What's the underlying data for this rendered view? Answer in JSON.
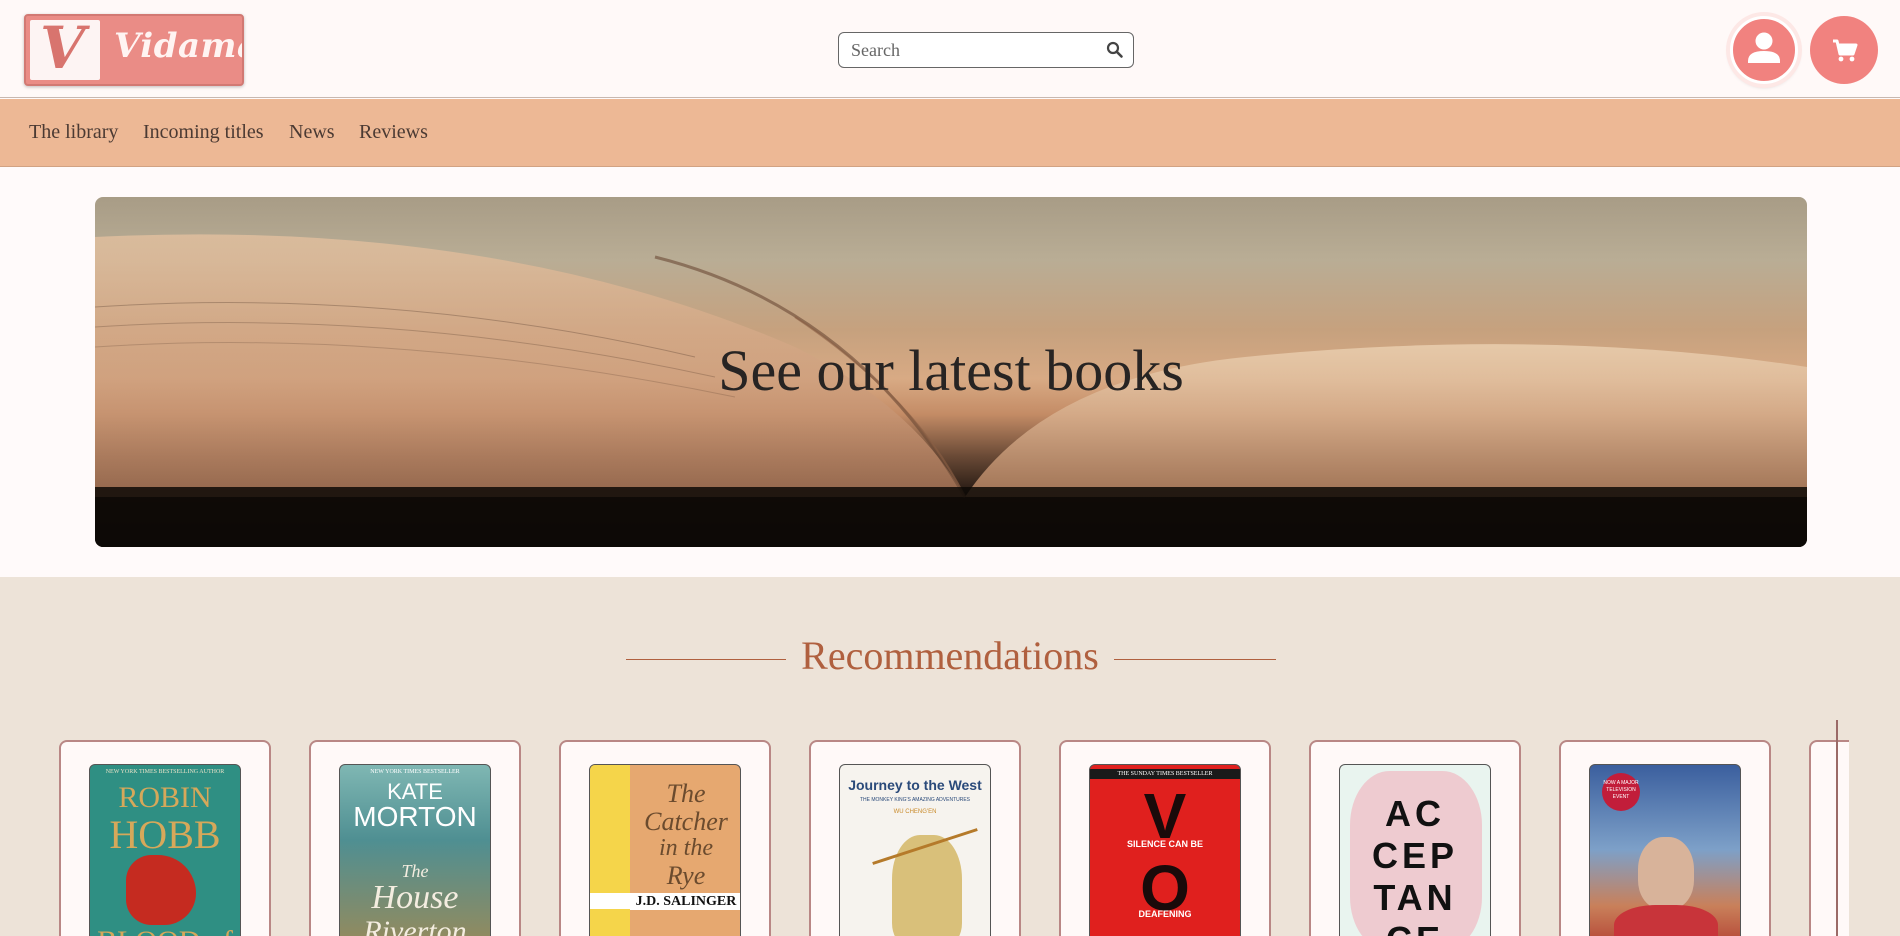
{
  "brand": {
    "logo_letter": "V",
    "logo_text": "Vidama"
  },
  "search": {
    "placeholder": "Search"
  },
  "nav": {
    "items": [
      "The library",
      "Incoming titles",
      "News",
      "Reviews"
    ]
  },
  "hero": {
    "title": "See our latest books"
  },
  "recommendations": {
    "title": "Recommendations",
    "books": [
      {
        "cover_lines": [
          "ROBIN",
          "HOBB",
          "BLOOD of"
        ],
        "tagline": "NEW YORK TIMES BESTSELLING AUTHOR"
      },
      {
        "cover_lines": [
          "KATE",
          "MORTON",
          "The",
          "House",
          "Riverton"
        ],
        "tagline": "NEW YORK TIMES BESTSELLER"
      },
      {
        "cover_lines": [
          "The",
          "Catcher",
          "in the",
          "Rye",
          "J.D. SALINGER"
        ]
      },
      {
        "cover_lines": [
          "Journey to the West",
          "THE MONKEY KING'S AMAZING ADVENTURES",
          "WU CHENG'EN"
        ]
      },
      {
        "cover_lines": [
          "V",
          "SILENCE CAN BE",
          "O",
          "DEAFENING"
        ],
        "tagline": "THE SUNDAY TIMES BESTSELLER"
      },
      {
        "cover_lines": [
          "AC",
          "CEP",
          "TAN",
          "CE"
        ]
      },
      {
        "cover_lines": [
          "NOW A MAJOR TELEVISION EVENT"
        ]
      }
    ]
  },
  "colors": {
    "accent": "#f1827f",
    "nav_bg": "#edb895",
    "rec_bg": "#ede3d8",
    "rec_title": "#b0603f"
  },
  "icons": {
    "search": "search-icon",
    "account": "user-icon",
    "cart": "cart-icon"
  }
}
